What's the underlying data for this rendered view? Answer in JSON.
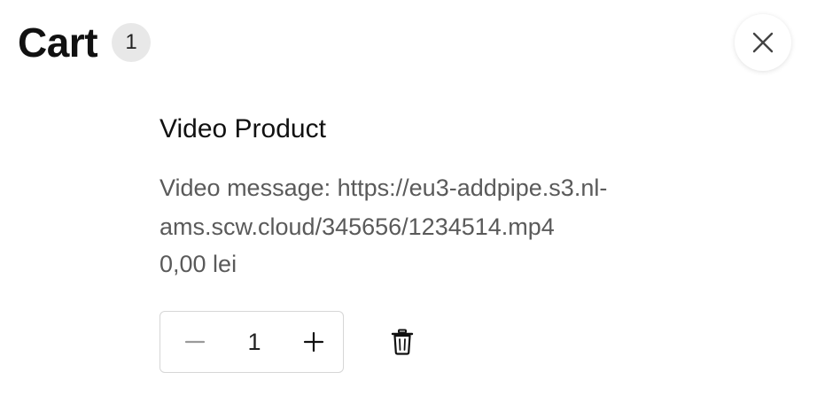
{
  "cart": {
    "title": "Cart",
    "count": "1"
  },
  "item": {
    "name": "Video Product",
    "meta": "Video message: https://eu3-addpipe.s3.nl-ams.scw.cloud/345656/1234514.mp4",
    "price": "0,00 lei",
    "quantity": "1"
  },
  "icons": {
    "close": "close-icon",
    "minus": "minus-icon",
    "plus": "plus-icon",
    "remove": "trash-icon"
  },
  "colors": {
    "title": "#111111",
    "muted": "#5a5a5a",
    "badge_bg": "#e8e8e8",
    "border": "#d6d6d6"
  }
}
